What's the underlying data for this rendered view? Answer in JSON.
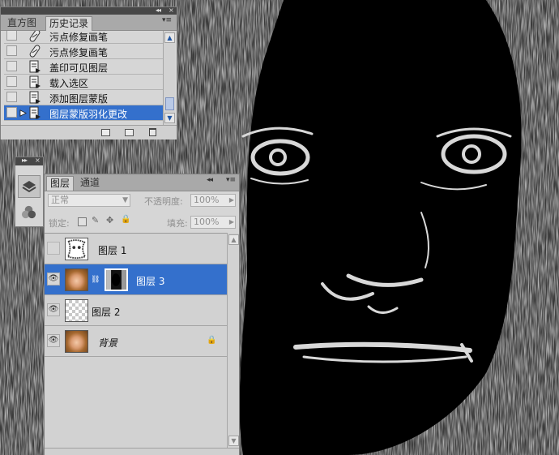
{
  "history_panel": {
    "tabs": [
      {
        "label": "直方图"
      },
      {
        "label": "历史记录"
      }
    ],
    "collapse_label": "◂◂",
    "close_label": "×",
    "items": [
      {
        "label": "污点修复画笔",
        "icon": "healing-brush-icon",
        "selected": false
      },
      {
        "label": "污点修复画笔",
        "icon": "healing-brush-icon",
        "selected": false
      },
      {
        "label": "盖印可见图层",
        "icon": "history-state-icon",
        "selected": false
      },
      {
        "label": "载入选区",
        "icon": "history-state-icon",
        "selected": false
      },
      {
        "label": "添加图层蒙版",
        "icon": "history-state-icon",
        "selected": false
      },
      {
        "label": "图层蒙版羽化更改",
        "icon": "history-state-icon",
        "selected": true
      }
    ],
    "footer_icons": [
      "new-document-from-state-icon",
      "new-snapshot-icon",
      "delete-state-icon"
    ]
  },
  "tool_dock": {
    "collapse_label": "▸▸",
    "close_label": "×",
    "buttons": [
      "layers-dock-icon",
      "channels-dock-icon"
    ]
  },
  "layers_panel": {
    "tabs": [
      {
        "label": "图层"
      },
      {
        "label": "通道"
      }
    ],
    "collapse_label": "◂◂",
    "close_label": "×",
    "blend_mode": "正常",
    "opacity_label": "不透明度:",
    "opacity_value": "100%",
    "lock_label": "锁定:",
    "fill_label": "填充:",
    "fill_value": "100%",
    "layers": [
      {
        "name": "图层 1",
        "visible": false,
        "selected": false,
        "thumb": "sketch"
      },
      {
        "name": "图层 3",
        "visible": true,
        "selected": true,
        "thumb": "portrait",
        "has_mask": true
      },
      {
        "name": "图层 2",
        "visible": true,
        "selected": false,
        "thumb": "transparent"
      },
      {
        "name": "背景",
        "visible": true,
        "selected": false,
        "thumb": "portrait",
        "locked": true
      }
    ]
  },
  "colors": {
    "selection": "#3470cc",
    "panel_bg": "#d6d6d6",
    "tab_bar": "#a9a9a9"
  }
}
